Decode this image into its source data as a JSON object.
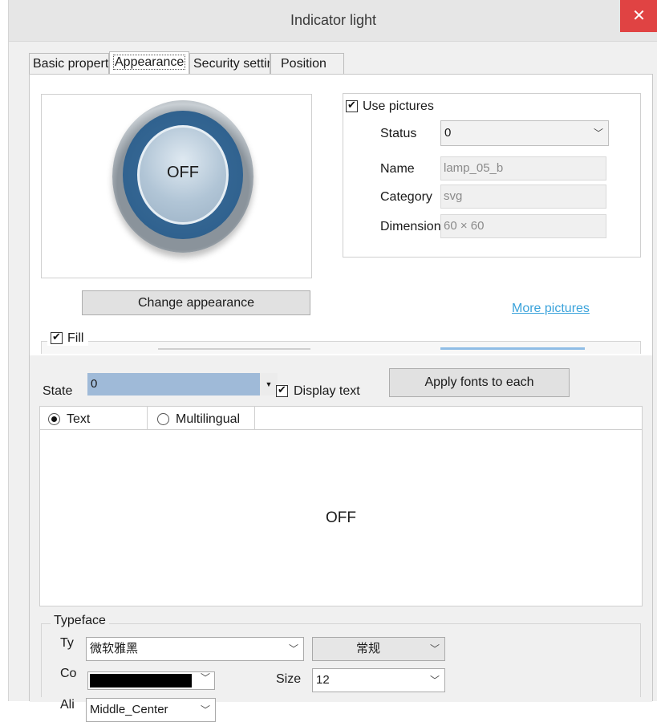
{
  "window": {
    "title": "Indicator light",
    "close_glyph": "✕"
  },
  "tabs": [
    {
      "label": "Basic properties",
      "active": false
    },
    {
      "label": "Appearance",
      "active": true
    },
    {
      "label": "Security settings",
      "active": false
    },
    {
      "label": "Position",
      "active": false
    }
  ],
  "preview": {
    "lamp_text": "OFF",
    "ring_color": "#30628f"
  },
  "change_appearance_label": "Change appearance",
  "pictures": {
    "use_pictures_label": "Use pictures",
    "use_pictures_checked": true,
    "status_label": "Status",
    "status_value": "0",
    "name_label": "Name",
    "name_value": "lamp_05_b",
    "category_label": "Category",
    "category_value": "svg",
    "dimension_label": "Dimension",
    "dimension_value": "60 × 60",
    "more_link": "More pictures"
  },
  "fill": {
    "label": "Fill",
    "checked": true
  },
  "state_row": {
    "state_label": "State",
    "state_value": "0",
    "display_text_label": "Display text",
    "display_text_checked": true,
    "apply_button": "Apply fonts to each"
  },
  "text_panel": {
    "subtabs": [
      {
        "label": "Text",
        "selected": true
      },
      {
        "label": "Multilingual",
        "selected": false
      }
    ],
    "preview_text": "OFF"
  },
  "typeface": {
    "legend": "Typeface",
    "type_label": "Ty",
    "font_value": "微软雅黑",
    "style_value": "常规",
    "color_label": "Co",
    "color_value": "#000000",
    "size_label": "Size",
    "size_value": "12",
    "align_label": "Ali",
    "align_value": "Middle_Center"
  },
  "colors": {
    "accent": "#3ba3db",
    "close": "#e04343",
    "selection": "#9fbad8"
  }
}
